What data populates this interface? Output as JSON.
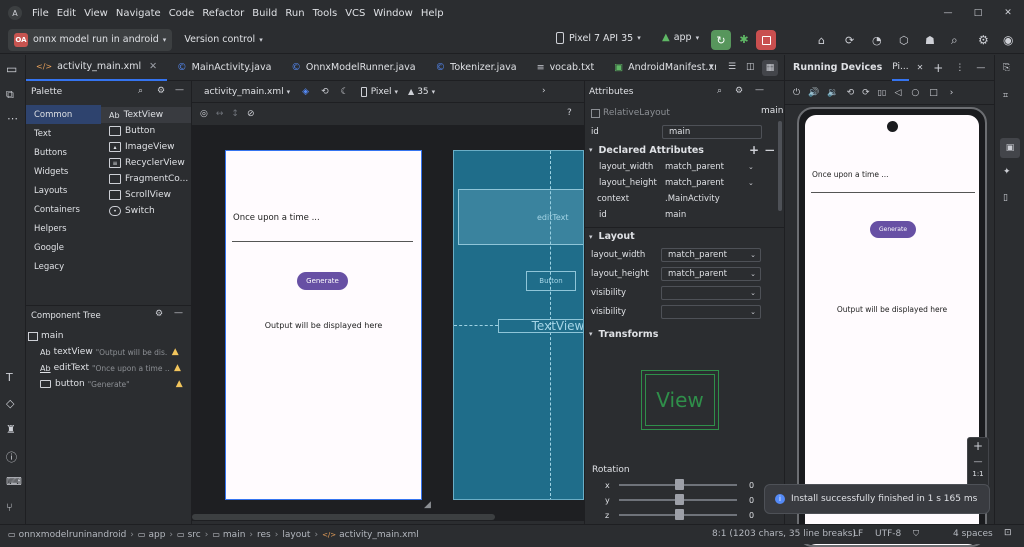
{
  "menu": [
    "File",
    "Edit",
    "View",
    "Navigate",
    "Code",
    "Refactor",
    "Build",
    "Run",
    "Tools",
    "VCS",
    "Window",
    "Help"
  ],
  "toolbar": {
    "project_badge": "OA",
    "project_name": "onnx model run in android",
    "vcs": "Version control",
    "device": "Pixel 7 API 35",
    "run_config": "app"
  },
  "tabs": [
    "activity_main.xml",
    "MainActivity.java",
    "OnnxModelRunner.java",
    "Tokenizer.java",
    "vocab.txt",
    "AndroidManifest.xml"
  ],
  "palette": {
    "title": "Palette",
    "categories": [
      "Common",
      "Text",
      "Buttons",
      "Widgets",
      "Layouts",
      "Containers",
      "Helpers",
      "Google",
      "Legacy"
    ],
    "items": [
      {
        "icon": "Ab",
        "label": "TextView"
      },
      {
        "icon": "",
        "label": "Button"
      },
      {
        "icon": "",
        "label": "ImageView"
      },
      {
        "icon": "",
        "label": "RecyclerView"
      },
      {
        "icon": "",
        "label": "FragmentCo..."
      },
      {
        "icon": "",
        "label": "ScrollView"
      },
      {
        "icon": "",
        "label": "Switch"
      }
    ]
  },
  "component_tree": {
    "title": "Component Tree",
    "root": "main",
    "children": [
      {
        "icon": "Ab",
        "name": "textView",
        "hint": "\"Output will be dis...\""
      },
      {
        "icon": "Ab",
        "name": "editText",
        "hint": "\"Once upon a time ...\""
      },
      {
        "icon": "",
        "name": "button",
        "hint": "\"Generate\""
      }
    ]
  },
  "design_toolbar": {
    "file": "activity_main.xml",
    "device": "Pixel",
    "api": "35"
  },
  "preview": {
    "edit_text": "Once upon a time ...",
    "button": "Generate",
    "output": "Output will be displayed here"
  },
  "blueprint": {
    "edit": "editText",
    "button": "Button",
    "text": "TextView"
  },
  "attributes": {
    "title": "Attributes",
    "class_name": "RelativeLayout",
    "id_value": "main",
    "id_label": "id",
    "declared_title": "Declared Attributes",
    "declared": [
      {
        "k": "layout_width",
        "v": "match_parent"
      },
      {
        "k": "layout_height",
        "v": "match_parent"
      },
      {
        "k": "context",
        "v": ".MainActivity"
      },
      {
        "k": "id",
        "v": "main"
      }
    ],
    "layout_title": "Layout",
    "layout": [
      {
        "k": "layout_width",
        "v": "match_parent"
      },
      {
        "k": "layout_height",
        "v": "match_parent"
      },
      {
        "k": "visibility",
        "v": ""
      },
      {
        "k": "visibility",
        "v": ""
      }
    ],
    "transforms_title": "Transforms",
    "view_label": "View",
    "rotation_title": "Rotation",
    "rotation": [
      {
        "axis": "x",
        "val": "0"
      },
      {
        "axis": "y",
        "val": "0"
      },
      {
        "axis": "z",
        "val": "0"
      }
    ]
  },
  "running": {
    "title": "Running Devices",
    "device_tab": "Pi...",
    "phone": {
      "edit_text": "Once upon a time ...",
      "button": "Generate",
      "output": "Output will be displayed here"
    },
    "zoom_ratio": "1:1"
  },
  "notification": "Install successfully finished in 1 s 165 ms",
  "status": {
    "crumbs": [
      "onnxmodelruninandroid",
      "app",
      "src",
      "main",
      "res",
      "layout",
      "activity_main.xml"
    ],
    "position": "8:1 (1203 chars, 35 line breaks)",
    "line_sep": "LF",
    "encoding": "UTF-8",
    "indent": "4 spaces"
  }
}
